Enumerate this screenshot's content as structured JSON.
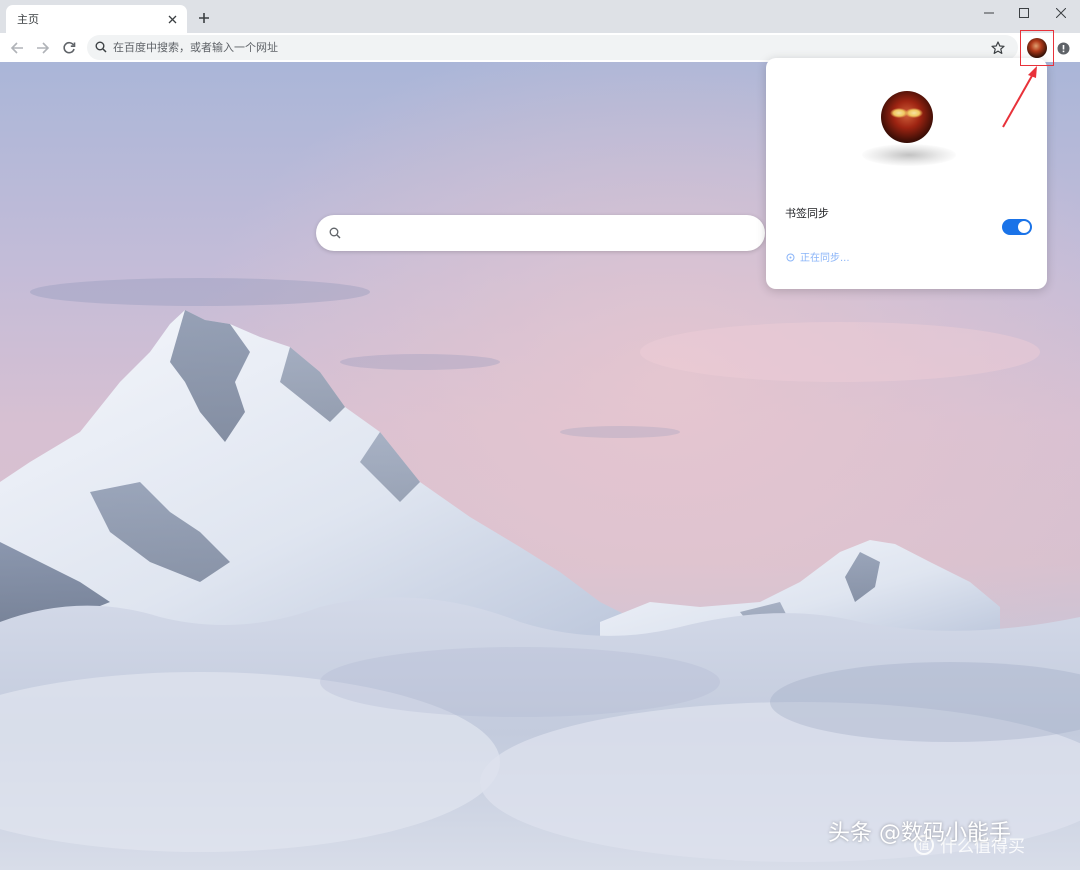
{
  "browser": {
    "tab": {
      "title": "主页"
    },
    "address_bar": {
      "placeholder": "在百度中搜索，或者输入一个网址"
    }
  },
  "profile_popup": {
    "sync_label": "书签同步",
    "sync_enabled": true,
    "sync_status": "正在同步..."
  },
  "watermark": {
    "text": "头条 @数码小能手",
    "secondary": "什么值得买",
    "secondary_icon": "值"
  },
  "icons": {
    "back": "arrow-left-icon",
    "forward": "arrow-right-icon",
    "reload": "reload-icon",
    "search": "search-icon",
    "star": "star-icon",
    "profile": "avatar",
    "alert": "alert-icon",
    "close": "close-icon",
    "new_tab": "plus-icon",
    "minimize": "minimize-icon",
    "maximize": "maximize-icon"
  },
  "colors": {
    "accent": "#1a73e8",
    "highlight": "#e8323a",
    "sync_status": "#8ab4f8"
  }
}
